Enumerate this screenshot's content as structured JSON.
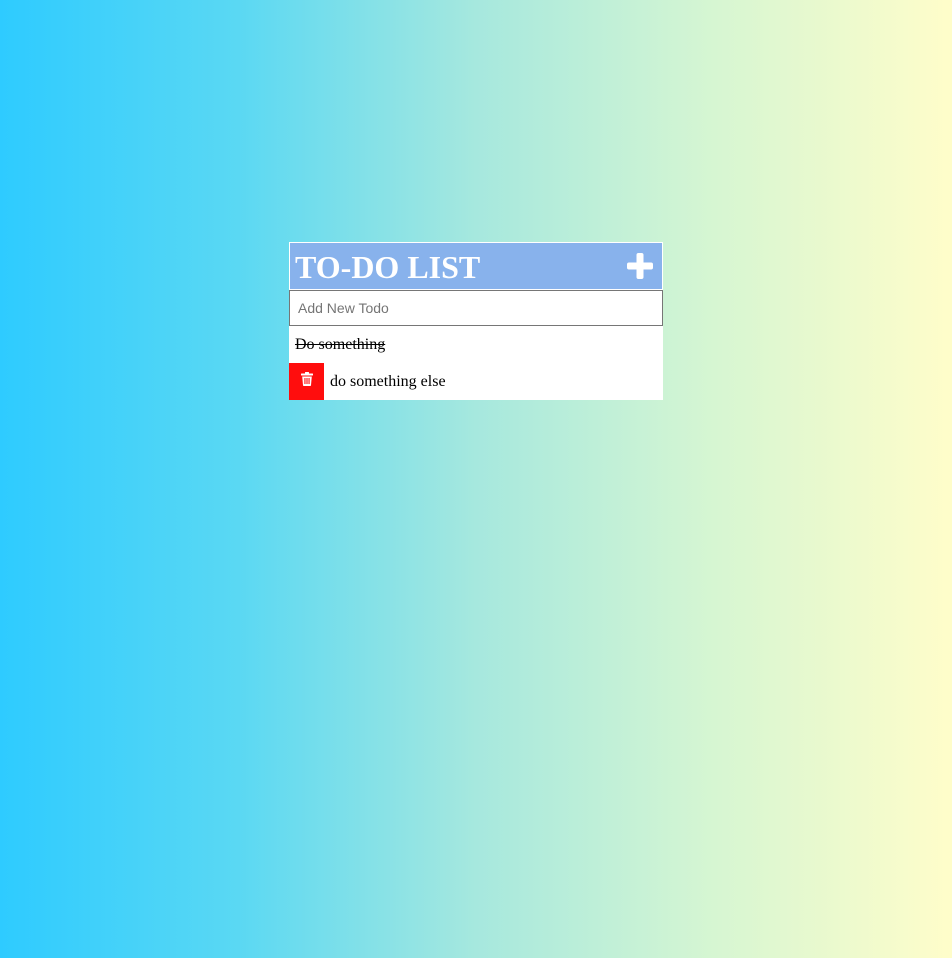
{
  "header": {
    "title": "TO-DO LIST",
    "add_icon": "plus-icon"
  },
  "new_todo": {
    "placeholder": "Add New Todo",
    "value": ""
  },
  "todos": [
    {
      "text": "Do something",
      "completed": true,
      "delete_visible": false
    },
    {
      "text": "do something else",
      "completed": false,
      "delete_visible": true
    }
  ],
  "colors": {
    "header_bg": "#88b2ec",
    "delete_bg": "#ff0d0d",
    "gradient_start": "#2ecbff",
    "gradient_end": "#fffdca"
  },
  "icons": {
    "delete": "trash-icon"
  }
}
